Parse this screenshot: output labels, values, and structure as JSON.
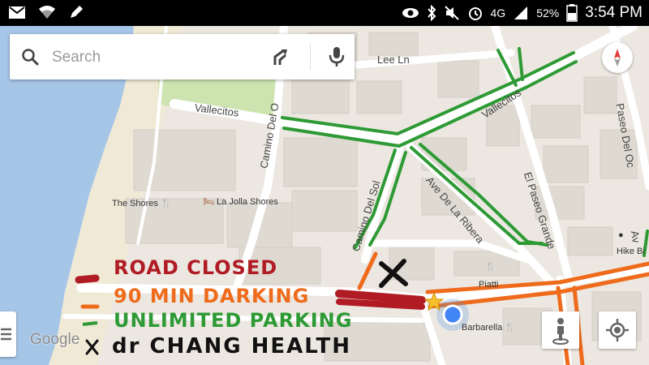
{
  "status_bar": {
    "left_icons": [
      "mail-icon",
      "wifi-icon",
      "pen-icon"
    ],
    "right_icons": [
      "eye-icon",
      "bluetooth-icon",
      "mute-icon",
      "alarm-icon",
      "network-icon",
      "signal-icon",
      "battery-icon"
    ],
    "network": "4G",
    "battery": "52%",
    "time": "3:54 PM"
  },
  "search": {
    "placeholder": "Search",
    "icon": "search-icon",
    "directions_icon": "directions-icon",
    "mic_icon": "mic-icon"
  },
  "map": {
    "streets": [
      "Lee Ln",
      "Vallecitos",
      "Vallecitos",
      "Camino Del O",
      "Camino Del Sol",
      "Ave De La Ribera",
      "El Paseo Grande",
      "Paseo Del Oc",
      "Av"
    ],
    "places": [
      {
        "name": "The Shores",
        "icon": "restaurant-icon"
      },
      {
        "name": "La Jolla Shores",
        "icon": "hotel-icon"
      },
      {
        "name": "Piatti",
        "icon": "restaurant-icon"
      },
      {
        "name": "Barbarella",
        "icon": "restaurant-icon"
      },
      {
        "name": "Hike Bi",
        "icon": "store-icon"
      }
    ],
    "attribution": "Google"
  },
  "legend": {
    "road_closed": "ROAD CLOSED",
    "min_parking": "90 MIN DARKING",
    "unlimited_parking": "UNLIMITED PARKING",
    "x_mark": "x",
    "chang": "dr CHANG HEALTH"
  },
  "colors": {
    "road_closed": "#b01b24",
    "min_parking": "#ef6b1c",
    "unlimited_parking": "#2e9a35",
    "water": "#a6c6e8",
    "park": "#cde4b1"
  }
}
